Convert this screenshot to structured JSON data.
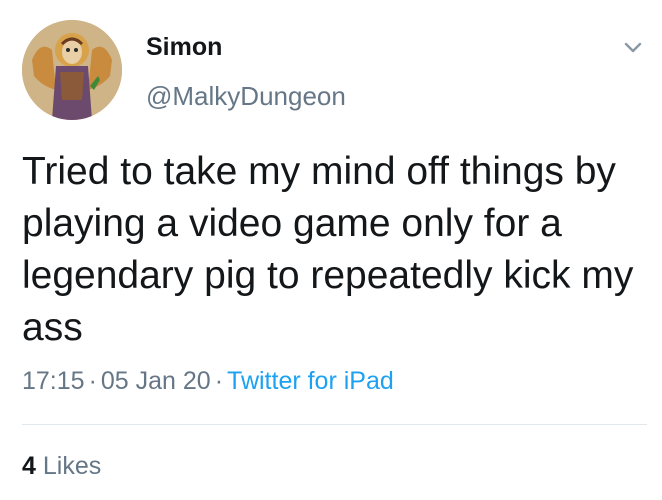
{
  "tweet": {
    "author": {
      "display_name": "Simon",
      "handle": "@MalkyDungeon",
      "avatar_icon": "illuminated-manuscript-figure-avatar"
    },
    "text": "Tried to take my mind off things by playing a video game only for a legendary pig to repeatedly kick my ass",
    "meta": {
      "time": "17:15",
      "separator": "·",
      "date": "05 Jan 20",
      "source": "Twitter for iPad"
    },
    "likes": {
      "count": "4",
      "label": "Likes"
    },
    "menu_icon": "chevron-down-icon"
  },
  "colors": {
    "primary_text": "#14171a",
    "secondary_text": "#657786",
    "link": "#1da1f2",
    "divider": "#e1e8ed",
    "background": "#ffffff"
  }
}
